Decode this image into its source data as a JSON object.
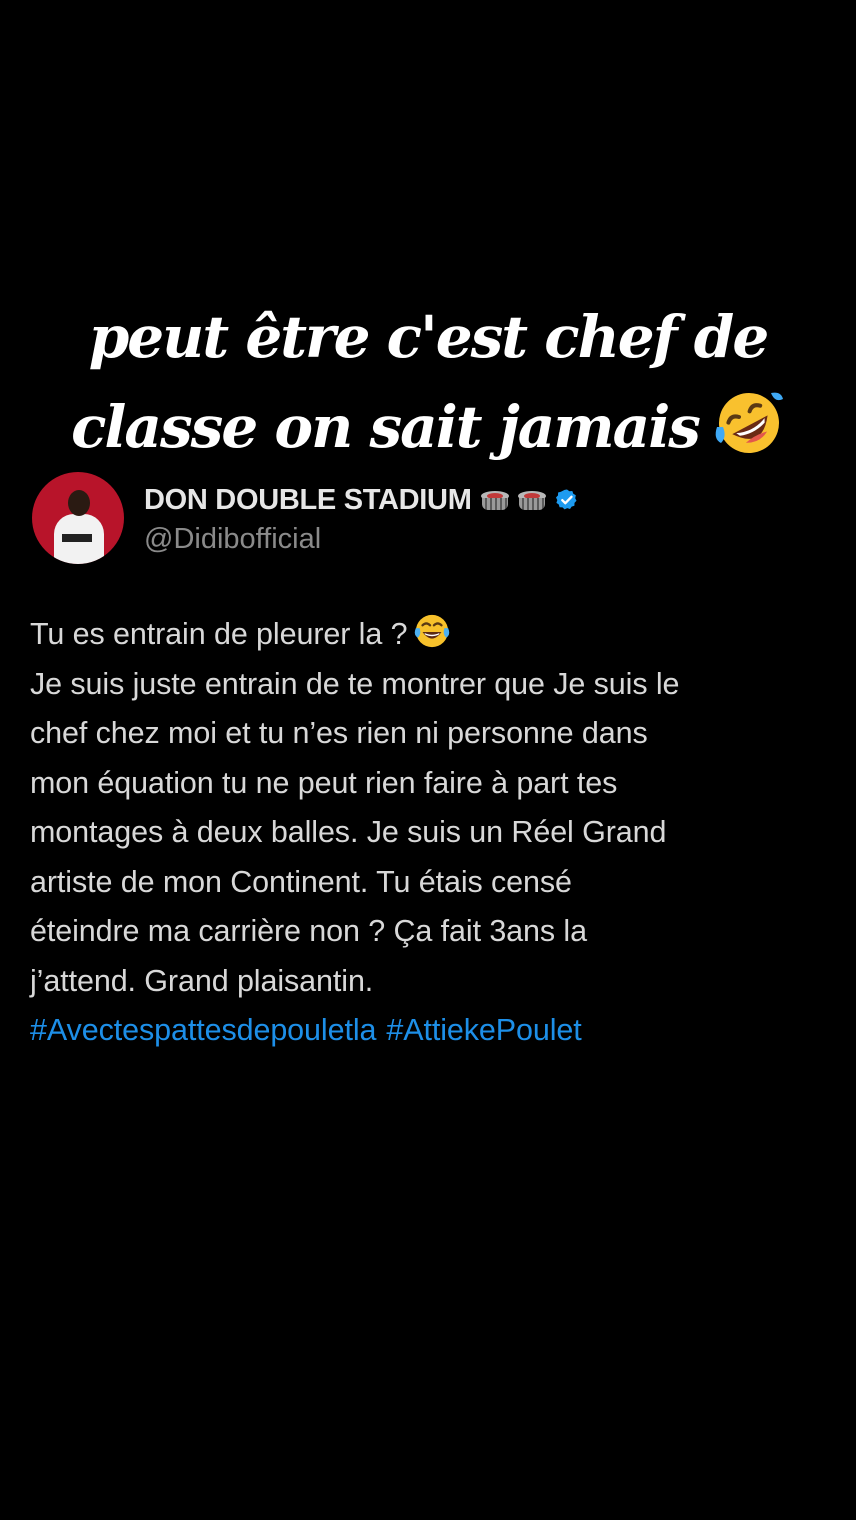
{
  "caption": {
    "line1": "peut être c'est chef de",
    "line2": "classe on sait jamais",
    "emoji": "rolling-on-floor-laughing-icon"
  },
  "tweet": {
    "display_name": "DON DOUBLE STADIUM",
    "name_icons": [
      "stadium-icon",
      "stadium-icon",
      "verified-icon"
    ],
    "handle": "@Didibofficial",
    "lines": [
      "Tu es entrain de pleurer la ?",
      "Je suis juste entrain de te montrer que Je suis le",
      "chef chez moi et tu n’es rien ni personne dans",
      "mon équation tu ne peut rien faire à part tes",
      "montages à deux balles. Je suis un Réel Grand",
      "artiste de mon Continent. Tu étais censé",
      "éteindre ma carrière non ? Ça fait 3ans la",
      "j’attend. Grand plaisantin."
    ],
    "first_line_emoji": "tears-of-joy-icon",
    "hashtags": [
      "#Avectespattesdepouletla",
      "#AttiekePoulet"
    ]
  },
  "colors": {
    "background": "#000000",
    "caption_text": "#ffffff",
    "tweet_text": "#d8d8d8",
    "handle_text": "#8a8a8a",
    "hashtag": "#1d8fe8",
    "verified_badge": "#1d9bf0"
  }
}
